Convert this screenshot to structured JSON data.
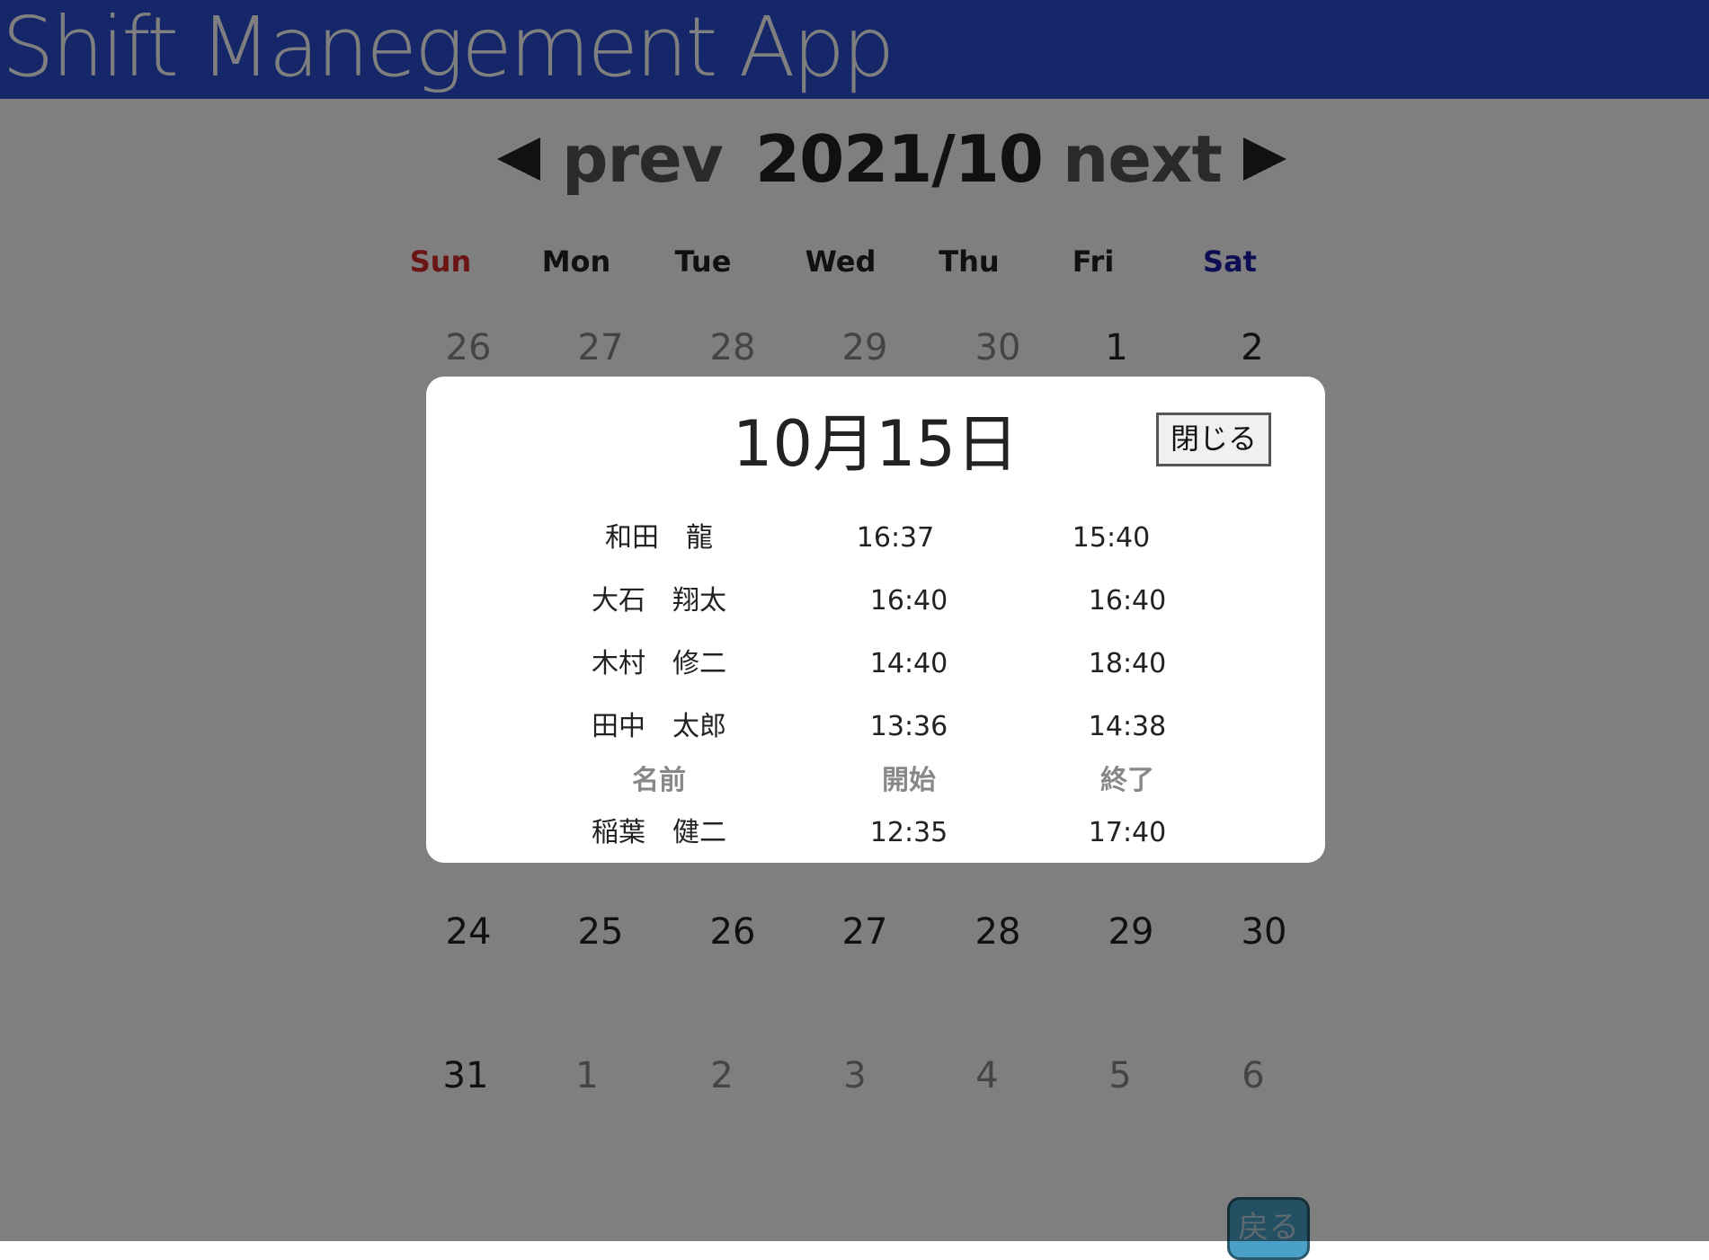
{
  "app": {
    "title": "Shift Manegement App"
  },
  "nav": {
    "prev_label": "prev",
    "next_label": "next",
    "month": "2021/10"
  },
  "weekdays": [
    "Sun",
    "Mon",
    "Tue",
    "Wed",
    "Thu",
    "Fri",
    "Sat"
  ],
  "weeks": [
    [
      {
        "d": "26",
        "other": true
      },
      {
        "d": "27",
        "other": true
      },
      {
        "d": "28",
        "other": true
      },
      {
        "d": "29",
        "other": true
      },
      {
        "d": "30",
        "other": true
      },
      {
        "d": "1",
        "other": false
      },
      {
        "d": "2",
        "other": false
      }
    ],
    [
      {
        "d": "24",
        "other": false
      },
      {
        "d": "25",
        "other": false
      },
      {
        "d": "26",
        "other": false
      },
      {
        "d": "27",
        "other": false
      },
      {
        "d": "28",
        "other": false
      },
      {
        "d": "29",
        "other": false
      },
      {
        "d": "30",
        "other": false
      }
    ],
    [
      {
        "d": "31",
        "other": false
      },
      {
        "d": "1",
        "other": true
      },
      {
        "d": "2",
        "other": true
      },
      {
        "d": "3",
        "other": true
      },
      {
        "d": "4",
        "other": true
      },
      {
        "d": "5",
        "other": true
      },
      {
        "d": "6",
        "other": true
      }
    ]
  ],
  "back_button": "戻る",
  "modal": {
    "title": "10月15日",
    "close_label": "閉じる",
    "headers": {
      "name": "名前",
      "start": "開始",
      "end": "終了"
    },
    "shifts_above": [
      {
        "name": "和田　龍",
        "start": "16:37",
        "end": "15:40"
      },
      {
        "name": "大石　翔太",
        "start": "16:40",
        "end": "16:40"
      },
      {
        "name": "木村　修二",
        "start": "14:40",
        "end": "18:40"
      },
      {
        "name": "田中　太郎",
        "start": "13:36",
        "end": "14:38"
      }
    ],
    "shifts_below": [
      {
        "name": "稲葉　健二",
        "start": "12:35",
        "end": "17:40"
      }
    ]
  }
}
